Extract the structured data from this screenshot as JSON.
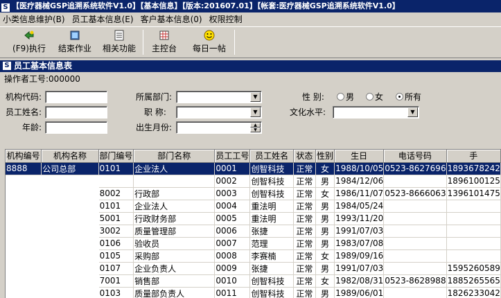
{
  "window": {
    "title": "【医疗器械GSP追溯系统软件V1.0】【基本信息】【版本:201607.01】【帐套:医疗器械GSP追溯系统软件V1.0】"
  },
  "menu": [
    "小类信息维护(B)",
    "员工基本信息(E)",
    "客户基本信息(0)",
    "权限控制"
  ],
  "toolbar": {
    "execute": "(F9)执行",
    "finish": "结束作业",
    "related": "相关功能",
    "console": "主控台",
    "daily": "每日一帖"
  },
  "panel": {
    "title": "员工基本信息表",
    "operator_label": "操作者工号:",
    "operator_id": "000000"
  },
  "form": {
    "org_code_label": "机构代码:",
    "emp_name_label": "员工姓名:",
    "age_label": "年龄:",
    "dept_label": "所属部门:",
    "position_label": "职 称:",
    "birth_month_label": "出生月份:",
    "gender_label": "性 别:",
    "gender_options": [
      "男",
      "女",
      "所有"
    ],
    "gender_selected": "所有",
    "education_label": "文化水平:"
  },
  "table": {
    "columns": [
      "机构编号",
      "机构名称",
      "部门编号",
      "部门名称",
      "员工工号",
      "员工姓名",
      "状态",
      "性别",
      "生日",
      "电话号码",
      "手"
    ],
    "rows": [
      [
        "8888",
        "公司总部",
        "0101",
        "企业法人",
        "0001",
        "创智科技",
        "正常",
        "女",
        "1988/10/05",
        "0523-8627696",
        "1893678242"
      ],
      [
        "",
        "",
        "",
        "",
        "0002",
        "创智科技",
        "正常",
        "男",
        "1984/12/06",
        "",
        "1896100125"
      ],
      [
        "",
        "",
        "8002",
        "行政部",
        "0003",
        "创智科技",
        "正常",
        "女",
        "1986/11/07",
        "0523-8666063",
        "1396101475"
      ],
      [
        "",
        "",
        "0101",
        "企业法人",
        "0004",
        "重法明",
        "正常",
        "男",
        "1984/05/24",
        "",
        ""
      ],
      [
        "",
        "",
        "5001",
        "行政财务部",
        "0005",
        "重法明",
        "正常",
        "男",
        "1993/11/20",
        "",
        ""
      ],
      [
        "",
        "",
        "3002",
        "质量管理部",
        "0006",
        "张捷",
        "正常",
        "男",
        "1991/07/03",
        "",
        ""
      ],
      [
        "",
        "",
        "0106",
        "验收员",
        "0007",
        "范理",
        "正常",
        "男",
        "1983/07/08",
        "",
        ""
      ],
      [
        "",
        "",
        "0105",
        "采购部",
        "0008",
        "李赛楠",
        "正常",
        "女",
        "1989/09/16",
        "",
        ""
      ],
      [
        "",
        "",
        "0107",
        "企业负责人",
        "0009",
        "张捷",
        "正常",
        "男",
        "1991/07/03",
        "",
        "1595260589"
      ],
      [
        "",
        "",
        "7001",
        "销售部",
        "0010",
        "创智科技",
        "正常",
        "女",
        "1982/08/31",
        "0523-8628988",
        "1885265565"
      ],
      [
        "",
        "",
        "0103",
        "质量部负责人",
        "0011",
        "创智科技",
        "正常",
        "男",
        "1989/06/01",
        "",
        "1826233042"
      ]
    ]
  },
  "colors": {
    "titlebar": "#0a246a",
    "face": "#d4d0c8",
    "selection": "#0a246a"
  }
}
